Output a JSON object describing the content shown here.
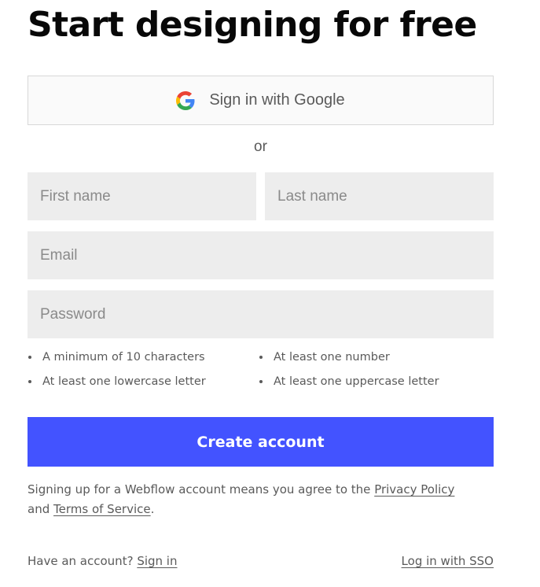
{
  "title": "Start designing for free",
  "google": {
    "label": "Sign in with Google",
    "icon": "google-g-icon"
  },
  "divider": "or",
  "fields": {
    "first_name": {
      "placeholder": "First name",
      "value": ""
    },
    "last_name": {
      "placeholder": "Last name",
      "value": ""
    },
    "email": {
      "placeholder": "Email",
      "value": ""
    },
    "password": {
      "placeholder": "Password",
      "value": ""
    }
  },
  "requirements": [
    "A minimum of 10 characters",
    "At least one number",
    "At least one lowercase letter",
    "At least one uppercase letter"
  ],
  "create_button": "Create account",
  "terms": {
    "prefix": "Signing up for a Webflow account means you agree to the",
    "privacy_link": "Privacy Policy",
    "and": "and",
    "tos_link": "Terms of Service",
    "suffix": "."
  },
  "footer": {
    "have_account": "Have an account?",
    "sign_in_link": "Sign in",
    "sso_link": "Log in with SSO"
  },
  "colors": {
    "primary": "#4353ff",
    "input_bg": "#ededed",
    "text_muted": "#5a5a5a"
  }
}
